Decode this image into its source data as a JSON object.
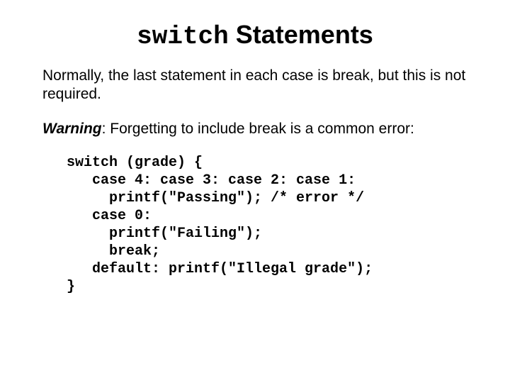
{
  "title": {
    "keyword": "switch",
    "rest": " Statements"
  },
  "para1": "Normally, the last statement in each case is break, but this is not required.",
  "warning": {
    "label": "Warning",
    "text": ": Forgetting to include break is a common error:"
  },
  "code": "switch (grade) {\n   case 4: case 3: case 2: case 1:\n     printf(\"Passing\"); /* error */\n   case 0:\n     printf(\"Failing\");\n     break;\n   default: printf(\"Illegal grade\");\n}"
}
